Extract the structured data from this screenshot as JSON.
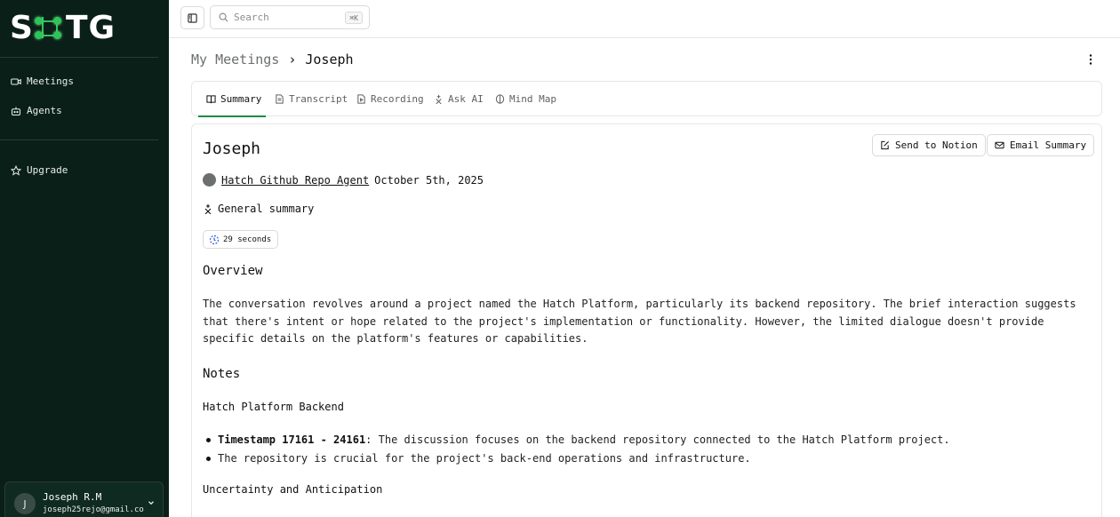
{
  "sidebar": {
    "logo": {
      "letter_left": "S",
      "letters_right": "TG",
      "dot_color": "#2ec45a"
    },
    "nav": [
      {
        "label": "Meetings",
        "icon": "video-icon"
      },
      {
        "label": "Agents",
        "icon": "bot-icon"
      }
    ],
    "upgrade": {
      "label": "Upgrade",
      "icon": "star-icon"
    },
    "user": {
      "initial": "J",
      "name": "Joseph R.M",
      "email": "joseph25rejo@gmail.co"
    }
  },
  "topbar": {
    "search_placeholder": "Search",
    "search_shortcut": "⌘K"
  },
  "breadcrumb": {
    "root": "My Meetings",
    "separator": "›",
    "current": "Joseph"
  },
  "tabs": [
    {
      "label": "Summary",
      "icon": "book-icon",
      "active": true
    },
    {
      "label": "Transcript",
      "icon": "file-text-icon",
      "active": false
    },
    {
      "label": "Recording",
      "icon": "file-video-icon",
      "active": false
    },
    {
      "label": "Ask AI",
      "icon": "sparkles-icon",
      "active": false
    },
    {
      "label": "Mind Map",
      "icon": "brain-icon",
      "active": false
    }
  ],
  "meeting": {
    "title": "Joseph",
    "actions": {
      "notion": "Send to Notion",
      "email": "Email Summary"
    },
    "agent_name": "Hatch Github Repo Agent",
    "date": "October 5th, 2025",
    "summary_label": "General summary",
    "duration": "29 seconds",
    "overview_heading": "Overview",
    "overview_text": "The conversation revolves around a project named the Hatch Platform, particularly its backend repository. The brief interaction suggests that there's intent or hope related to the project's implementation or functionality. However, the limited dialogue doesn't provide specific details on the platform's features or capabilities.",
    "notes_heading": "Notes",
    "section1_heading": "Hatch Platform Backend",
    "section1_bullets": [
      {
        "bold": "Timestamp 17161 - 24161",
        "text": ": The discussion focuses on the backend repository connected to the Hatch Platform project."
      },
      {
        "bold": "",
        "text": "The repository is crucial for the project's back-end operations and infrastructure."
      }
    ],
    "section2_heading": "Uncertainty and Anticipation"
  },
  "colors": {
    "sidebar_bg": "#0a1f18",
    "accent": "#1f8a45"
  }
}
